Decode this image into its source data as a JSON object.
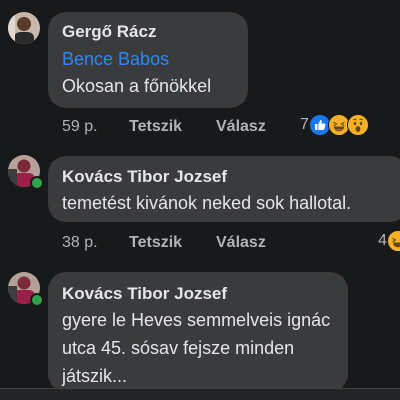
{
  "comments": [
    {
      "author": "Gergő Rácz",
      "mention": "Bence Babos",
      "lines": [
        "Okosan a főnökkel"
      ],
      "time": "59 p.",
      "like_label": "Tetszik",
      "reply_label": "Válasz",
      "reaction_count": "7",
      "reactions": [
        "like-icon",
        "haha-icon",
        "wow-icon"
      ],
      "online": false
    },
    {
      "author": "Kovács Tibor Jozsef",
      "lines": [
        "temetést kivánok neked sok hallotal."
      ],
      "time": "38 p.",
      "like_label": "Tetszik",
      "reply_label": "Válasz",
      "reaction_count": "4",
      "reactions": [
        "haha-icon"
      ],
      "online": true
    },
    {
      "author": "Kovács Tibor Jozsef",
      "lines": [
        "gyere le Heves semmelveis ignác",
        "utca 45. sósav fejsze minden",
        "játszik..."
      ],
      "online": true
    }
  ],
  "colors": {
    "background": "#18191a",
    "bubble": "#3a3b3c",
    "author_text": "#e4e6eb",
    "mention": "#2d88ff",
    "meta_text": "#b0b3b8",
    "like_blue": "#1877f2",
    "reaction_yellow": "#f7b125",
    "online_green": "#31a24c"
  }
}
